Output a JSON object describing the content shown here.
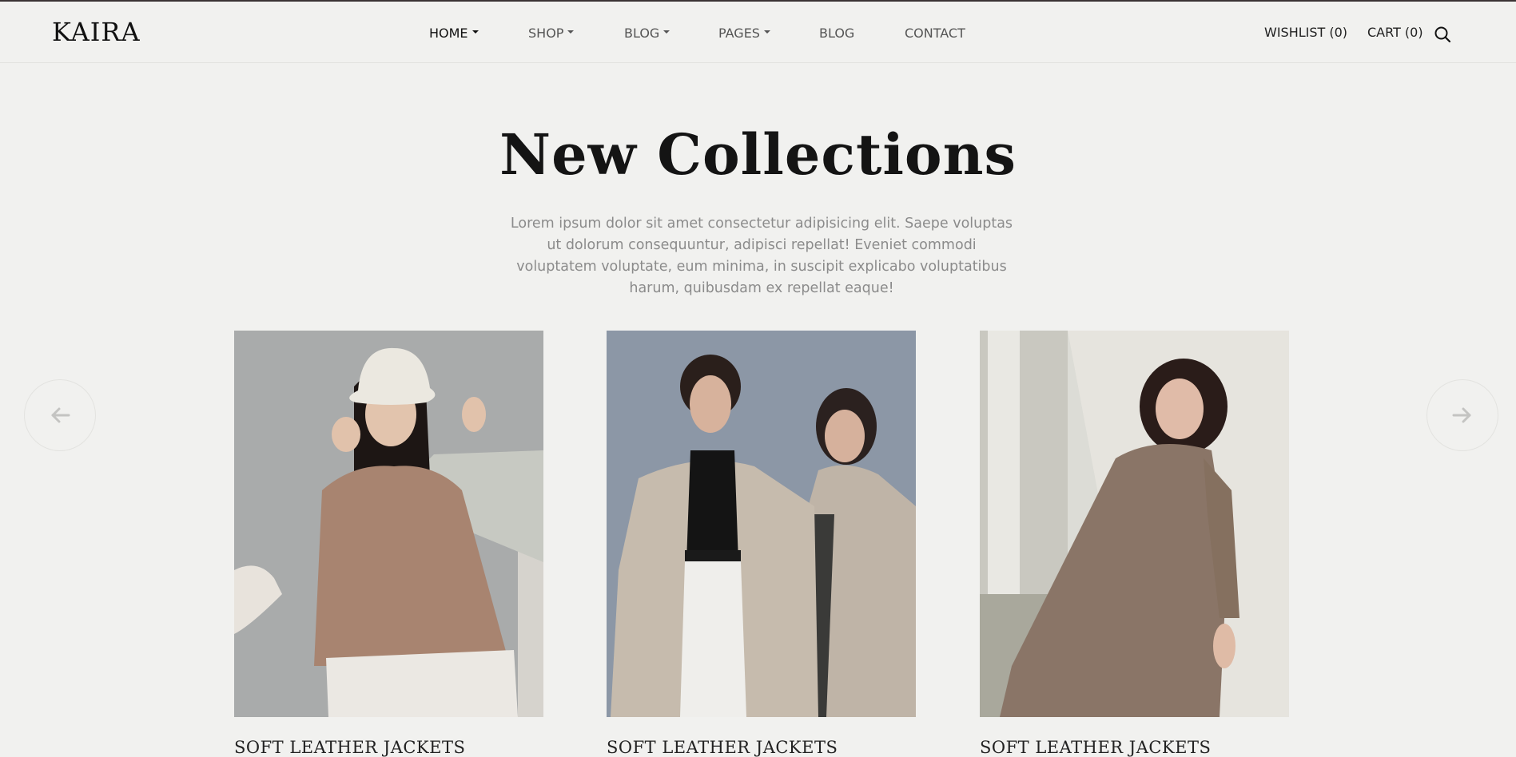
{
  "brand": {
    "logo": "KAIRA"
  },
  "nav": {
    "home": "HOME",
    "shop": "SHOP",
    "blog_menu": "BLOG",
    "pages": "PAGES",
    "blog": "BLOG",
    "contact": "CONTACT"
  },
  "header_actions": {
    "wishlist": "WISHLIST (0)",
    "cart": "CART (0)"
  },
  "hero": {
    "title": "New Collections",
    "description": "Lorem ipsum dolor sit amet consectetur adipisicing elit. Saepe voluptas ut dolorum consequuntur, adipisci repellat! Eveniet commodi voluptatem voluptate, eum minima, in suscipit explicabo voluptatibus harum, quibusdam ex repellat eaque!"
  },
  "products": [
    {
      "name": "SOFT LEATHER JACKETS"
    },
    {
      "name": "SOFT LEATHER JACKETS"
    },
    {
      "name": "SOFT LEATHER JACKETS"
    }
  ],
  "colors": {
    "background": "#f1f1ef",
    "text": "#222222",
    "muted": "#8b8b8b"
  }
}
